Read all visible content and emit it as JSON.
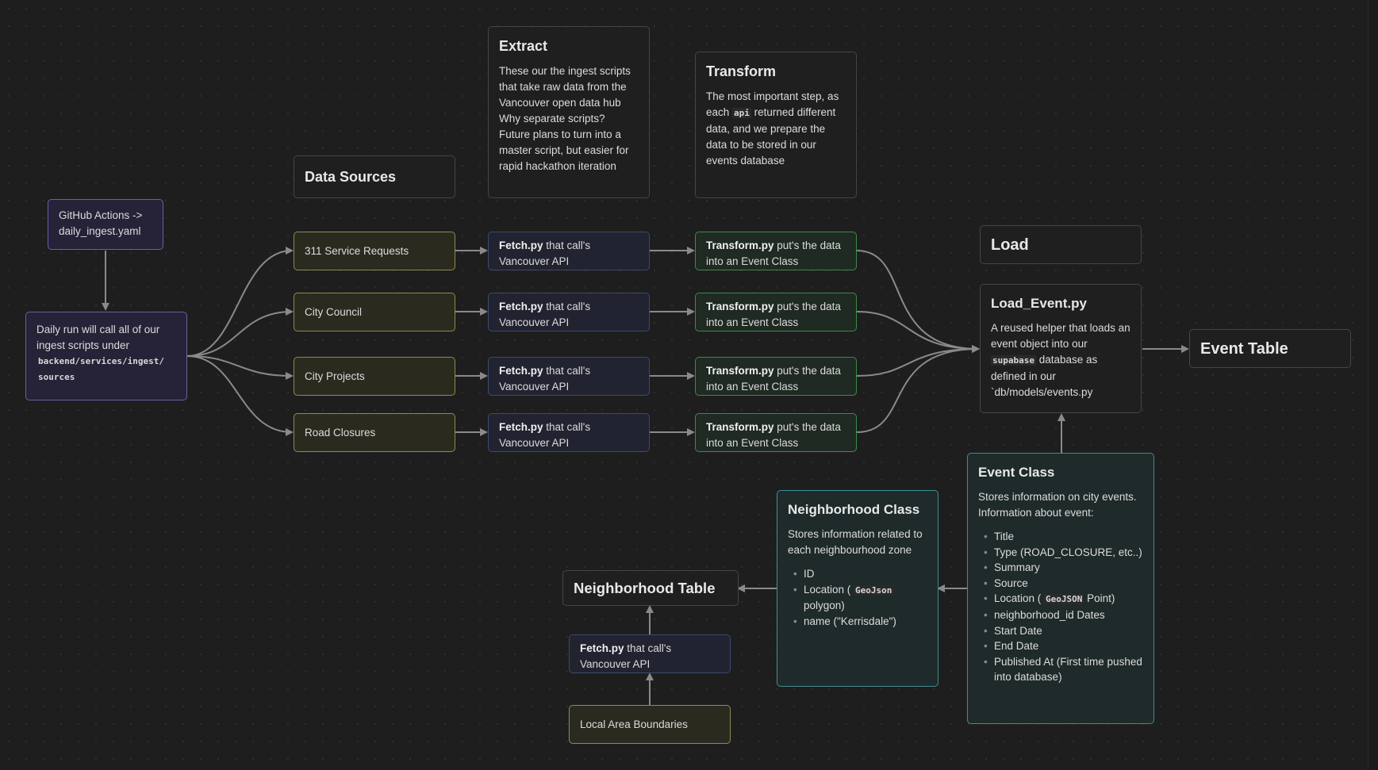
{
  "extract": {
    "title": "Extract",
    "body": "These our the ingest scripts that take raw data from the Vancouver open data hub Why separate scripts? Future plans to turn into a master script, but easier for rapid hackathon iteration"
  },
  "transform": {
    "title": "Transform",
    "body_pre": "The most important step, as each ",
    "body_code": "api",
    "body_post": " returned different data, and we prepare the data to be stored in our events database"
  },
  "data_sources": {
    "title": "Data Sources"
  },
  "github": {
    "text": "GitHub Actions -> daily_ingest.yaml"
  },
  "daily": {
    "text": "Daily run will call all of our ingest scripts under",
    "code": "backend/services/ingest/ sources"
  },
  "sources": [
    {
      "label": "311 Service Requests"
    },
    {
      "label": "City Council"
    },
    {
      "label": "City Projects"
    },
    {
      "label": "Road Closures"
    }
  ],
  "fetch": {
    "bold": "Fetch.py",
    "rest": " that call's Vancouver API"
  },
  "transform_node": {
    "bold": "Transform.py",
    "rest": " put's the data into an Event Class"
  },
  "load": {
    "title": "Load"
  },
  "load_event": {
    "title": "Load_Event.py",
    "pre": "A reused helper that loads an event object into our ",
    "code": "supabase",
    "post": " database as defined in our `db/models/events.py"
  },
  "event_table": {
    "title": "Event Table"
  },
  "event_class": {
    "title": "Event Class",
    "body": "Stores information on city events. Information about event:",
    "items": [
      "Title",
      "Type (ROAD_CLOSURE, etc..)",
      "Summary",
      "Source",
      "Location ( ",
      "neighborhood_id Dates",
      "Start Date",
      "End Date",
      "Published At (First time pushed into database)"
    ],
    "location_code": "GeoJSON",
    "location_post": " Point)"
  },
  "neighborhood_class": {
    "title": "Neighborhood Class",
    "body": "Stores information related to each neighbourhood zone",
    "items": [
      "ID",
      "Location ( ",
      "name (\"Kerrisdale\")"
    ],
    "location_code": "GeoJson",
    "location_post": " polygon)"
  },
  "neighborhood_table": {
    "title": "Neighborhood Table"
  },
  "local_area": {
    "label": "Local Area Boundaries"
  },
  "colors": {
    "edge": "#8a8a8a",
    "yellow": "#8f8b4e",
    "blue": "#3c4a6a",
    "green": "#3c8b4b",
    "purple": "#6e5ea6",
    "teal": "#3e8e93"
  }
}
